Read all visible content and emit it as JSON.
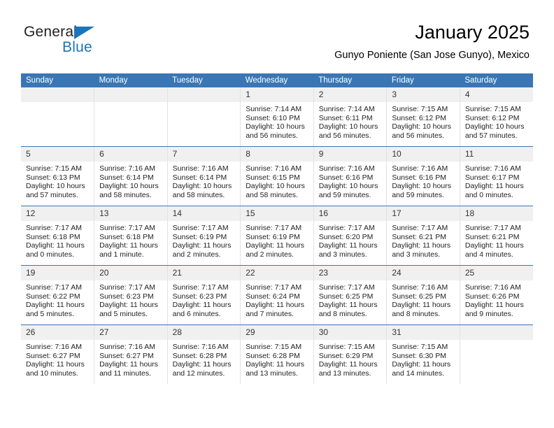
{
  "brand": {
    "name_top": "General",
    "name_bottom": "Blue",
    "accent_color": "#1b75bb",
    "triangle_icon": "triangle-icon"
  },
  "header": {
    "title": "January 2025",
    "subtitle": "Gunyo Poniente (San Jose Gunyo), Mexico"
  },
  "theme": {
    "header_blue": "#3b76b4",
    "daynum_band": "#f0f0f0",
    "cell_border": "#e2e2e2"
  },
  "calendar": {
    "weekday_headers": [
      "Sunday",
      "Monday",
      "Tuesday",
      "Wednesday",
      "Thursday",
      "Friday",
      "Saturday"
    ],
    "weeks": [
      [
        {
          "day": "",
          "lines": []
        },
        {
          "day": "",
          "lines": []
        },
        {
          "day": "",
          "lines": []
        },
        {
          "day": "1",
          "lines": [
            "Sunrise: 7:14 AM",
            "Sunset: 6:10 PM",
            "Daylight: 10 hours",
            "and 56 minutes."
          ]
        },
        {
          "day": "2",
          "lines": [
            "Sunrise: 7:14 AM",
            "Sunset: 6:11 PM",
            "Daylight: 10 hours",
            "and 56 minutes."
          ]
        },
        {
          "day": "3",
          "lines": [
            "Sunrise: 7:15 AM",
            "Sunset: 6:12 PM",
            "Daylight: 10 hours",
            "and 56 minutes."
          ]
        },
        {
          "day": "4",
          "lines": [
            "Sunrise: 7:15 AM",
            "Sunset: 6:12 PM",
            "Daylight: 10 hours",
            "and 57 minutes."
          ]
        }
      ],
      [
        {
          "day": "5",
          "lines": [
            "Sunrise: 7:15 AM",
            "Sunset: 6:13 PM",
            "Daylight: 10 hours",
            "and 57 minutes."
          ]
        },
        {
          "day": "6",
          "lines": [
            "Sunrise: 7:16 AM",
            "Sunset: 6:14 PM",
            "Daylight: 10 hours",
            "and 58 minutes."
          ]
        },
        {
          "day": "7",
          "lines": [
            "Sunrise: 7:16 AM",
            "Sunset: 6:14 PM",
            "Daylight: 10 hours",
            "and 58 minutes."
          ]
        },
        {
          "day": "8",
          "lines": [
            "Sunrise: 7:16 AM",
            "Sunset: 6:15 PM",
            "Daylight: 10 hours",
            "and 58 minutes."
          ]
        },
        {
          "day": "9",
          "lines": [
            "Sunrise: 7:16 AM",
            "Sunset: 6:16 PM",
            "Daylight: 10 hours",
            "and 59 minutes."
          ]
        },
        {
          "day": "10",
          "lines": [
            "Sunrise: 7:16 AM",
            "Sunset: 6:16 PM",
            "Daylight: 10 hours",
            "and 59 minutes."
          ]
        },
        {
          "day": "11",
          "lines": [
            "Sunrise: 7:16 AM",
            "Sunset: 6:17 PM",
            "Daylight: 11 hours",
            "and 0 minutes."
          ]
        }
      ],
      [
        {
          "day": "12",
          "lines": [
            "Sunrise: 7:17 AM",
            "Sunset: 6:18 PM",
            "Daylight: 11 hours",
            "and 0 minutes."
          ]
        },
        {
          "day": "13",
          "lines": [
            "Sunrise: 7:17 AM",
            "Sunset: 6:18 PM",
            "Daylight: 11 hours",
            "and 1 minute."
          ]
        },
        {
          "day": "14",
          "lines": [
            "Sunrise: 7:17 AM",
            "Sunset: 6:19 PM",
            "Daylight: 11 hours",
            "and 2 minutes."
          ]
        },
        {
          "day": "15",
          "lines": [
            "Sunrise: 7:17 AM",
            "Sunset: 6:19 PM",
            "Daylight: 11 hours",
            "and 2 minutes."
          ]
        },
        {
          "day": "16",
          "lines": [
            "Sunrise: 7:17 AM",
            "Sunset: 6:20 PM",
            "Daylight: 11 hours",
            "and 3 minutes."
          ]
        },
        {
          "day": "17",
          "lines": [
            "Sunrise: 7:17 AM",
            "Sunset: 6:21 PM",
            "Daylight: 11 hours",
            "and 3 minutes."
          ]
        },
        {
          "day": "18",
          "lines": [
            "Sunrise: 7:17 AM",
            "Sunset: 6:21 PM",
            "Daylight: 11 hours",
            "and 4 minutes."
          ]
        }
      ],
      [
        {
          "day": "19",
          "lines": [
            "Sunrise: 7:17 AM",
            "Sunset: 6:22 PM",
            "Daylight: 11 hours",
            "and 5 minutes."
          ]
        },
        {
          "day": "20",
          "lines": [
            "Sunrise: 7:17 AM",
            "Sunset: 6:23 PM",
            "Daylight: 11 hours",
            "and 5 minutes."
          ]
        },
        {
          "day": "21",
          "lines": [
            "Sunrise: 7:17 AM",
            "Sunset: 6:23 PM",
            "Daylight: 11 hours",
            "and 6 minutes."
          ]
        },
        {
          "day": "22",
          "lines": [
            "Sunrise: 7:17 AM",
            "Sunset: 6:24 PM",
            "Daylight: 11 hours",
            "and 7 minutes."
          ]
        },
        {
          "day": "23",
          "lines": [
            "Sunrise: 7:17 AM",
            "Sunset: 6:25 PM",
            "Daylight: 11 hours",
            "and 8 minutes."
          ]
        },
        {
          "day": "24",
          "lines": [
            "Sunrise: 7:16 AM",
            "Sunset: 6:25 PM",
            "Daylight: 11 hours",
            "and 8 minutes."
          ]
        },
        {
          "day": "25",
          "lines": [
            "Sunrise: 7:16 AM",
            "Sunset: 6:26 PM",
            "Daylight: 11 hours",
            "and 9 minutes."
          ]
        }
      ],
      [
        {
          "day": "26",
          "lines": [
            "Sunrise: 7:16 AM",
            "Sunset: 6:27 PM",
            "Daylight: 11 hours",
            "and 10 minutes."
          ]
        },
        {
          "day": "27",
          "lines": [
            "Sunrise: 7:16 AM",
            "Sunset: 6:27 PM",
            "Daylight: 11 hours",
            "and 11 minutes."
          ]
        },
        {
          "day": "28",
          "lines": [
            "Sunrise: 7:16 AM",
            "Sunset: 6:28 PM",
            "Daylight: 11 hours",
            "and 12 minutes."
          ]
        },
        {
          "day": "29",
          "lines": [
            "Sunrise: 7:15 AM",
            "Sunset: 6:28 PM",
            "Daylight: 11 hours",
            "and 13 minutes."
          ]
        },
        {
          "day": "30",
          "lines": [
            "Sunrise: 7:15 AM",
            "Sunset: 6:29 PM",
            "Daylight: 11 hours",
            "and 13 minutes."
          ]
        },
        {
          "day": "31",
          "lines": [
            "Sunrise: 7:15 AM",
            "Sunset: 6:30 PM",
            "Daylight: 11 hours",
            "and 14 minutes."
          ]
        },
        {
          "day": "",
          "lines": []
        }
      ]
    ]
  }
}
